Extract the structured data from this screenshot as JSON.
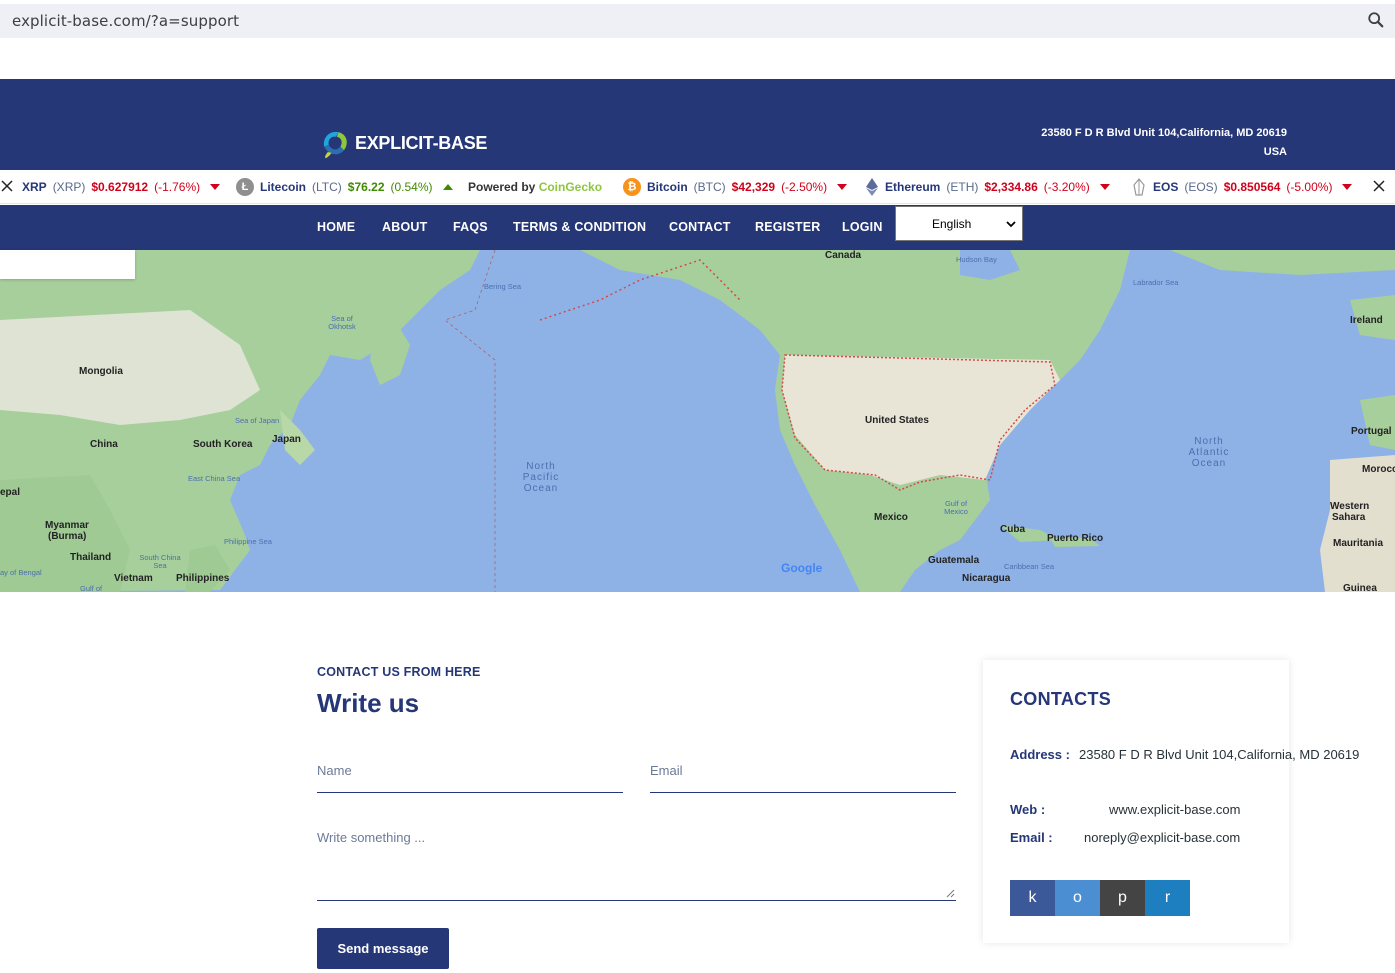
{
  "browser": {
    "url": "explicit-base.com/?a=support"
  },
  "header": {
    "logo_text": "EXPLICIT-BASE",
    "address_line1": "23580 F D R Blvd Unit 104,California, MD 20619",
    "address_line2": "USA"
  },
  "ticker": {
    "items": [
      {
        "name": "XRP",
        "symbol": "(XRP)",
        "price": "$0.627912",
        "change": "(-1.76%)",
        "direction": "down"
      },
      {
        "name": "Litecoin",
        "symbol": "(LTC)",
        "price": "$76.22",
        "change": "(0.54%)",
        "direction": "up"
      },
      {
        "name": "Bitcoin",
        "symbol": "(BTC)",
        "price": "$42,329",
        "change": "(-2.50%)",
        "direction": "down"
      },
      {
        "name": "Ethereum",
        "symbol": "(ETH)",
        "price": "$2,334.86",
        "change": "(-3.20%)",
        "direction": "down"
      },
      {
        "name": "EOS",
        "symbol": "(EOS)",
        "price": "$0.850564",
        "change": "(-5.00%)",
        "direction": "down"
      }
    ],
    "powered_prefix": "Powered by ",
    "powered_brand": "CoinGecko"
  },
  "nav": {
    "items": [
      "HOME",
      "ABOUT",
      "FAQS",
      "TERMS & CONDITION",
      "CONTACT",
      "REGISTER",
      "LOGIN"
    ],
    "language": "English"
  },
  "map": {
    "countries": [
      "Canada",
      "Mongolia",
      "China",
      "South Korea",
      "Japan",
      "Myanmar",
      "(Burma)",
      "Thailand",
      "Vietnam",
      "Philippines",
      "United States",
      "Mexico",
      "Cuba",
      "Puerto Rico",
      "Guatemala",
      "Nicaragua",
      "Ireland",
      "Portugal",
      "Morocco",
      "Western",
      "Sahara",
      "Mauritania",
      "Guinea",
      "epal"
    ],
    "waters": [
      "Bering Sea",
      "Sea of Okhotsk",
      "Sea of Japan",
      "East China Sea",
      "Philippine Sea",
      "South China Sea",
      "North Pacific Ocean",
      "Hudson Bay",
      "Labrador Sea",
      "North Atlantic Ocean",
      "Gulf of Mexico",
      "Caribbean Sea",
      "ay of Bengal",
      "Gulf of"
    ],
    "attribution": "Google"
  },
  "form": {
    "subtitle": "CONTACT US FROM HERE",
    "title": "Write us",
    "name_placeholder": "Name",
    "email_placeholder": "Email",
    "message_placeholder": "Write something ...",
    "send_label": "Send message"
  },
  "contacts": {
    "title": "CONTACTS",
    "address_label": "Address :",
    "address_value": "23580 F D R Blvd Unit 104,California, MD 20619",
    "web_label": "Web :",
    "web_value": "www.explicit-base.com",
    "email_label": "Email :",
    "email_value": "noreply@explicit-base.com",
    "socials": [
      {
        "label": "k",
        "color": "#3b5998"
      },
      {
        "label": "o",
        "color": "#4b8fd2"
      },
      {
        "label": "p",
        "color": "#444444"
      },
      {
        "label": "r",
        "color": "#1d7fc0"
      }
    ]
  },
  "colors": {
    "brand_navy": "#253777",
    "price_down": "#d0021b",
    "price_up": "#3f8b00",
    "map_water": "#8fb2e6"
  }
}
